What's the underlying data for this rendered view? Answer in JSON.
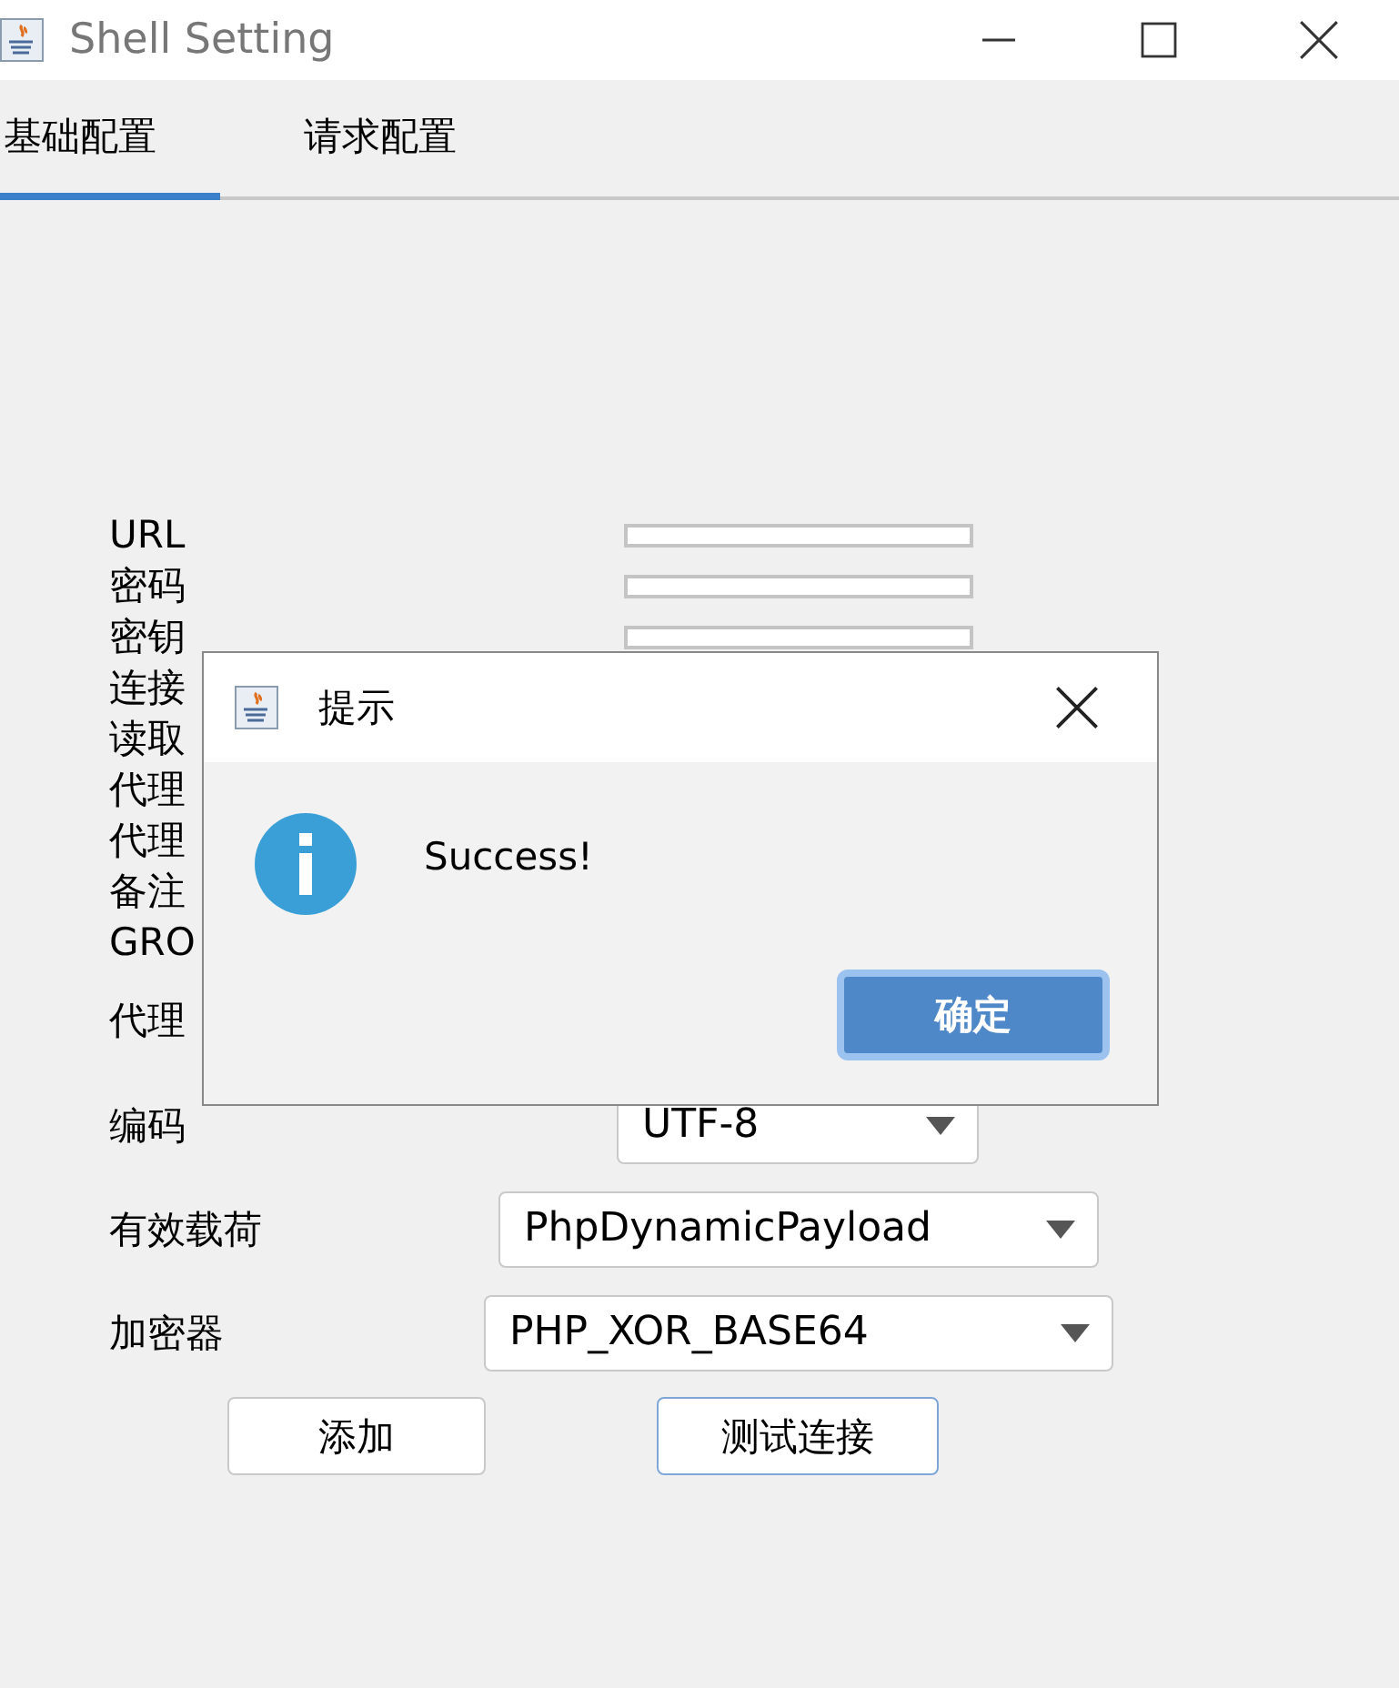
{
  "window": {
    "title": "Shell Setting"
  },
  "tabs": [
    {
      "label": "基础配置",
      "selected": true
    },
    {
      "label": "请求配置",
      "selected": false
    }
  ],
  "form": {
    "rows": [
      {
        "label": "URL",
        "kind": "field"
      },
      {
        "label": "密码",
        "kind": "field"
      },
      {
        "label": "密钥",
        "kind": "field"
      },
      {
        "label": "连接",
        "kind": "covered"
      },
      {
        "label": "读取",
        "kind": "covered"
      },
      {
        "label": "代理",
        "kind": "covered"
      },
      {
        "label": "代理",
        "kind": "covered"
      },
      {
        "label": "备注",
        "kind": "covered"
      },
      {
        "label": "GRO",
        "kind": "covered"
      },
      {
        "label": "代理",
        "kind": "covered"
      },
      {
        "label": "编码",
        "kind": "combo",
        "value": "UTF-8"
      },
      {
        "label": "有效载荷",
        "kind": "combo",
        "value": "PhpDynamicPayload"
      },
      {
        "label": "加密器",
        "kind": "combo",
        "value": "PHP_XOR_BASE64"
      }
    ]
  },
  "buttons": [
    {
      "label": "添加",
      "focused": false
    },
    {
      "label": "测试连接",
      "focused": true
    }
  ],
  "dialog": {
    "title": "提示",
    "message": "Success!",
    "ok": "确定"
  }
}
